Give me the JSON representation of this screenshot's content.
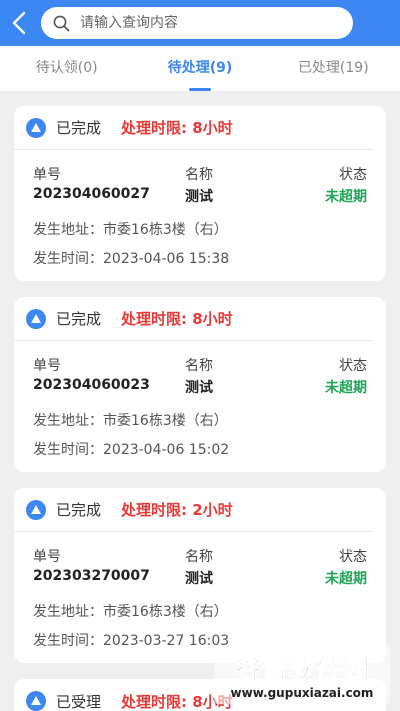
{
  "search": {
    "placeholder": "请输入查询内容"
  },
  "tabs": [
    {
      "label": "待认领(0)"
    },
    {
      "label": "待处理(9)"
    },
    {
      "label": "已处理(19)"
    }
  ],
  "columns": {
    "number": "单号",
    "name": "名称",
    "state": "状态"
  },
  "cards": [
    {
      "status": "已完成",
      "limit": "处理时限: 8小时",
      "number": "202304060027",
      "name": "测试",
      "state": "未超期",
      "address": "发生地址：市委16栋3楼（右）",
      "time": "发生时间：2023-04-06 15:38"
    },
    {
      "status": "已完成",
      "limit": "处理时限: 8小时",
      "number": "202304060023",
      "name": "测试",
      "state": "未超期",
      "address": "发生地址：市委16栋3楼（右）",
      "time": "发生时间：2023-04-06 15:02"
    },
    {
      "status": "已完成",
      "limit": "处理时限: 2小时",
      "number": "202303270007",
      "name": "测试",
      "state": "未超期",
      "address": "发生地址：市委16栋3楼（右）",
      "time": "发生时间：2023-03-27 16:03"
    },
    {
      "status": "已受理",
      "limit": "处理时限: 8小时"
    }
  ],
  "watermark": {
    "title": "谷普软件园",
    "url": "www.gupuxiazai.com"
  },
  "colors": {
    "primary": "#3d87f5",
    "danger": "#e93a3a",
    "success": "#21a658"
  }
}
